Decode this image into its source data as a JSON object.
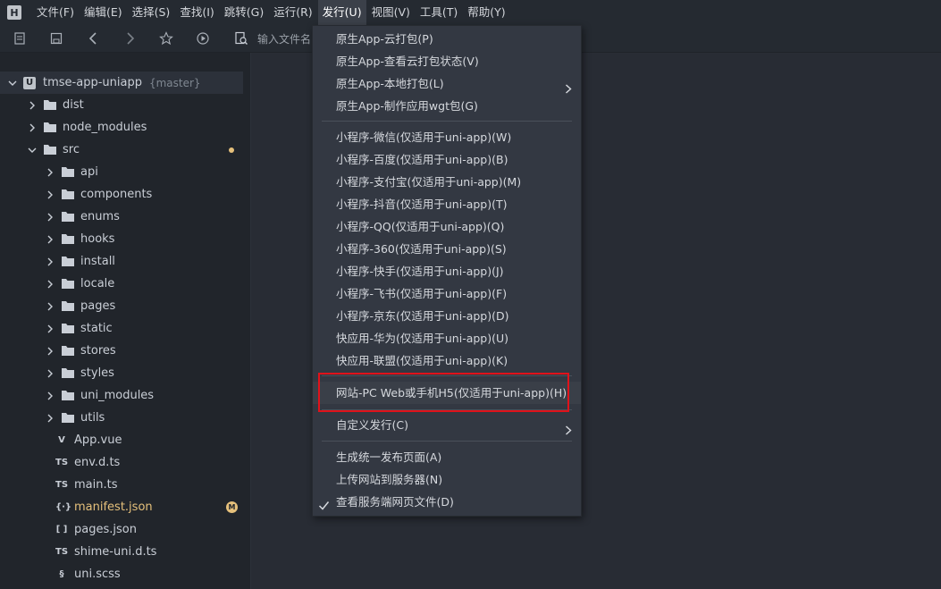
{
  "menubar": {
    "items": [
      "文件(F)",
      "编辑(E)",
      "选择(S)",
      "查找(I)",
      "跳转(G)",
      "运行(R)",
      "发行(U)",
      "视图(V)",
      "工具(T)",
      "帮助(Y)"
    ],
    "active_index": 6
  },
  "toolbar": {
    "search_placeholder": "输入文件名"
  },
  "sidebar": {
    "root": {
      "name": "tmse-app-uniapp",
      "branch": "{master}"
    },
    "level1": [
      "dist",
      "node_modules",
      "src"
    ],
    "src_children_folders": [
      "api",
      "components",
      "enums",
      "hooks",
      "install",
      "locale",
      "pages",
      "static",
      "stores",
      "styles",
      "uni_modules",
      "utils"
    ],
    "src_children_files": [
      {
        "icon": "V",
        "name": "App.vue"
      },
      {
        "icon": "TS",
        "name": "env.d.ts"
      },
      {
        "icon": "TS",
        "name": "main.ts"
      },
      {
        "icon": "{·}",
        "name": "manifest.json",
        "badge": "M"
      },
      {
        "icon": "[ ]",
        "name": "pages.json"
      },
      {
        "icon": "TS",
        "name": "shime-uni.d.ts"
      },
      {
        "icon": "§",
        "name": "uni.scss"
      }
    ]
  },
  "publish_menu": {
    "group1": [
      "原生App-云打包(P)",
      "原生App-查看云打包状态(V)",
      "原生App-本地打包(L)",
      "原生App-制作应用wgt包(G)"
    ],
    "group2": [
      "小程序-微信(仅适用于uni-app)(W)",
      "小程序-百度(仅适用于uni-app)(B)",
      "小程序-支付宝(仅适用于uni-app)(M)",
      "小程序-抖音(仅适用于uni-app)(T)",
      "小程序-QQ(仅适用于uni-app)(Q)",
      "小程序-360(仅适用于uni-app)(S)",
      "小程序-快手(仅适用于uni-app)(J)",
      "小程序-飞书(仅适用于uni-app)(F)",
      "小程序-京东(仅适用于uni-app)(D)",
      "快应用-华为(仅适用于uni-app)(U)",
      "快应用-联盟(仅适用于uni-app)(K)"
    ],
    "web": "网站-PC Web或手机H5(仅适用于uni-app)(H)",
    "custom": "自定义发行(C)",
    "group4": [
      "生成统一发布页面(A)",
      "上传网站到服务器(N)",
      "查看服务端网页文件(D)"
    ]
  },
  "colors": {
    "highlight_box": "#e0121a",
    "modified": "#e5c07b"
  }
}
